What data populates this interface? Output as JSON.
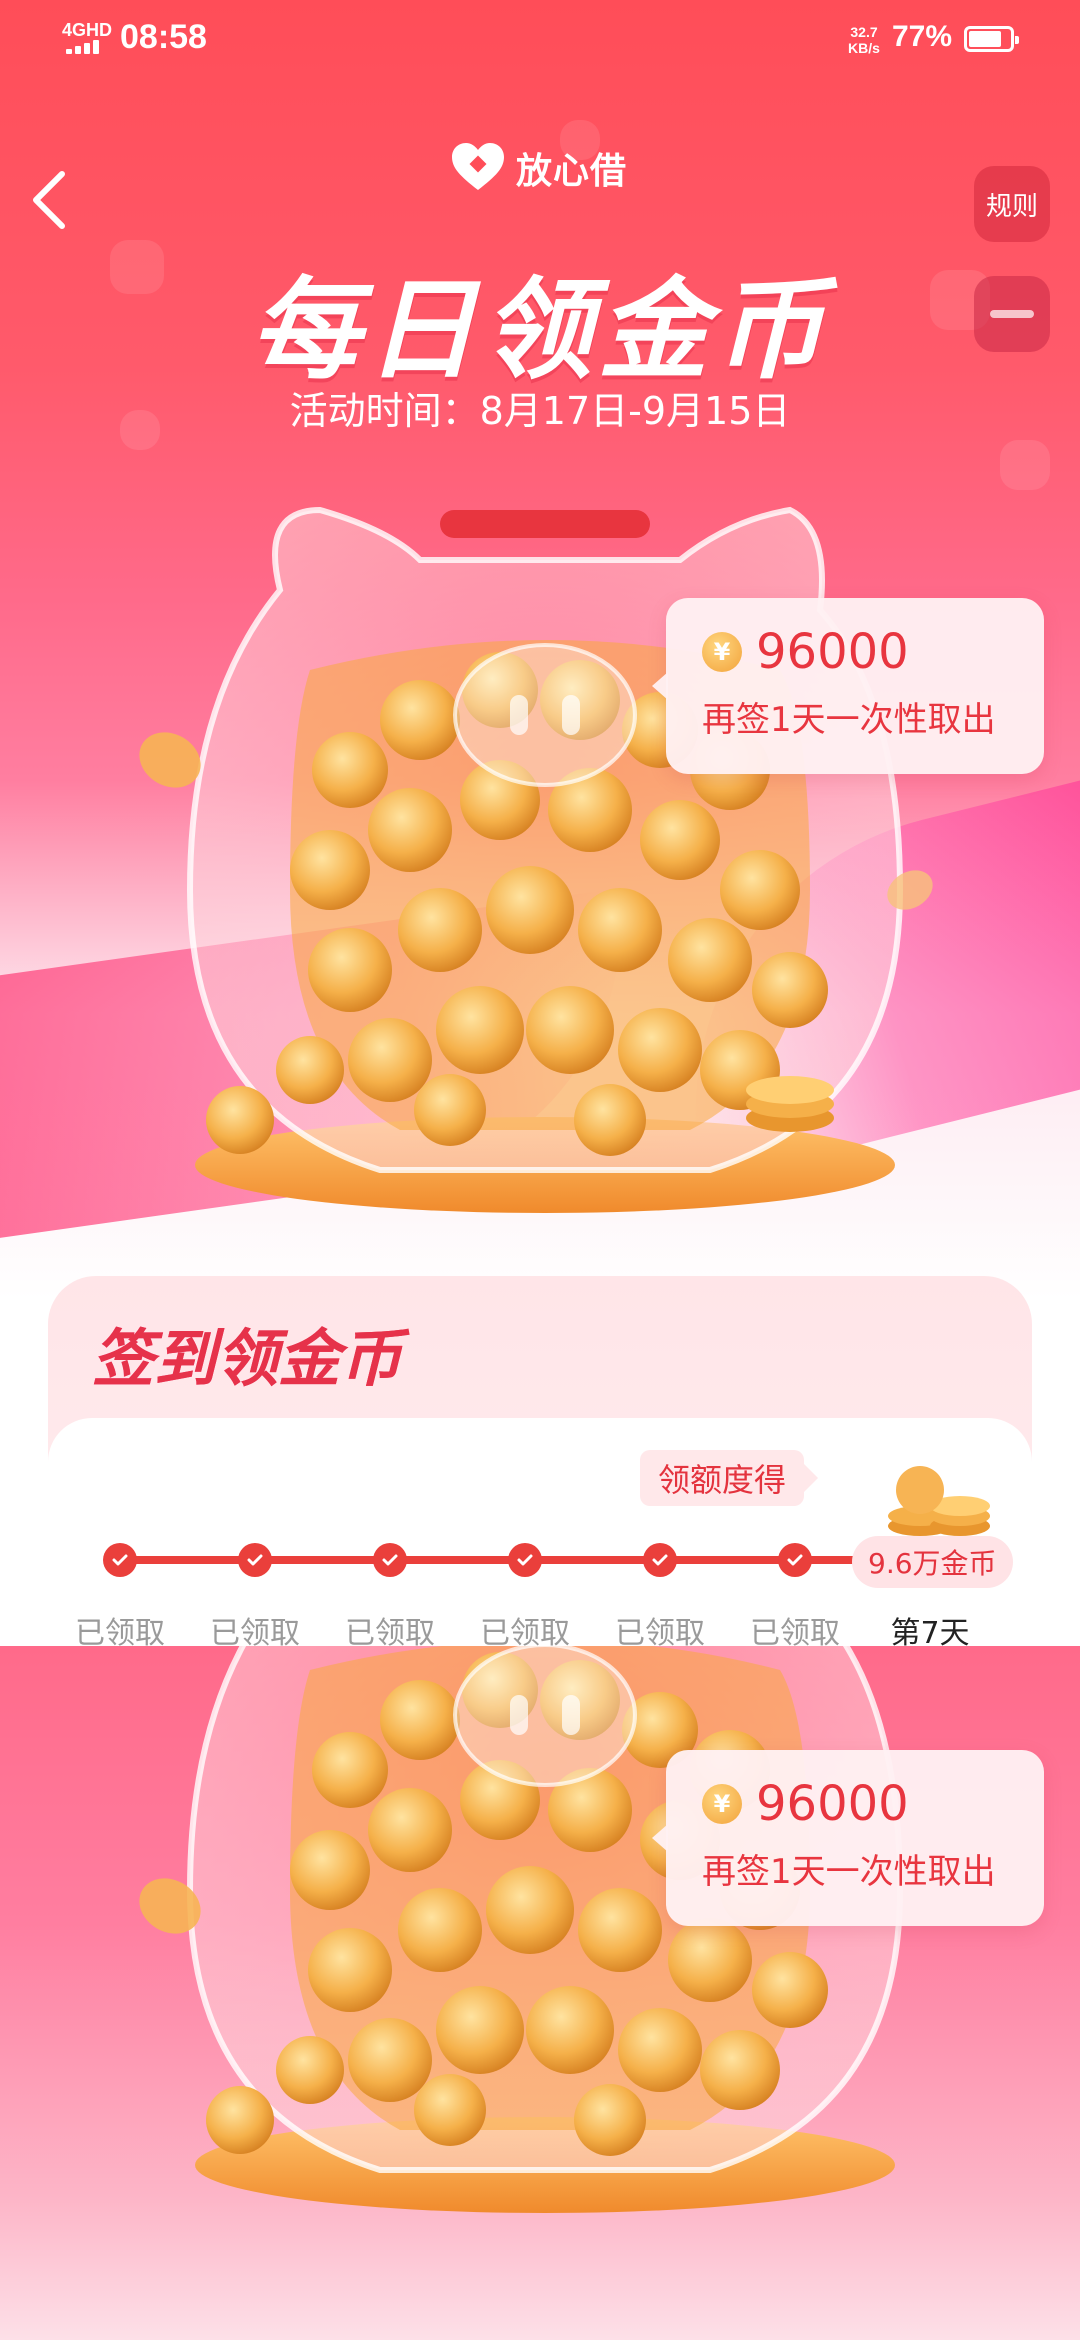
{
  "status_bar": {
    "network": "4GHD",
    "time": "08:58",
    "speed_value": "32.7",
    "speed_unit": "KB/s",
    "battery": "77%"
  },
  "header": {
    "brand_name": "放心借",
    "rules_label": "规则",
    "back_icon": "chevron-left-icon",
    "share_icon": "more-icon"
  },
  "hero": {
    "title": "每日领金币",
    "activity_time": "活动时间：8月17日-9月15日",
    "bubble_amount": "96000",
    "bubble_subtitle": "再签1天一次性取出",
    "yen_symbol": "¥"
  },
  "checkin": {
    "title": "签到领金币",
    "tip": "领额度得",
    "reward": "9.6万金币",
    "progress_completed": 6,
    "days": [
      {
        "label": "已领取",
        "status": "claimed"
      },
      {
        "label": "已领取",
        "status": "claimed"
      },
      {
        "label": "已领取",
        "status": "claimed"
      },
      {
        "label": "已领取",
        "status": "claimed"
      },
      {
        "label": "已领取",
        "status": "claimed"
      },
      {
        "label": "已领取",
        "status": "claimed"
      },
      {
        "label": "第7天",
        "status": "current"
      }
    ]
  },
  "hero_repeat": {
    "bubble_amount": "96000",
    "bubble_subtitle": "再签1天一次性取出",
    "yen_symbol": "¥"
  },
  "colors": {
    "brand_red": "#ea3f3b",
    "hero_top": "#ff4d58",
    "hero_pink": "#ff7ea0",
    "coin_gold": "#f2a23a"
  }
}
